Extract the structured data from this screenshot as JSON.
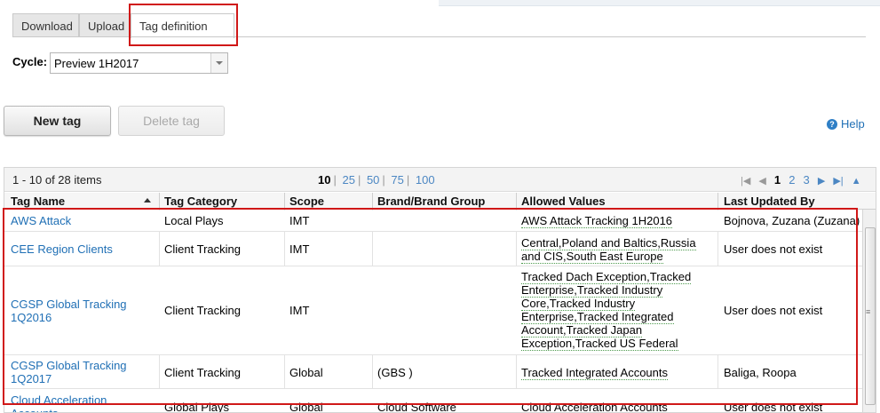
{
  "tabs": [
    {
      "label": "Download"
    },
    {
      "label": "Upload"
    },
    {
      "label": "Tag definition"
    }
  ],
  "cycle": {
    "label": "Cycle:",
    "value": "Preview 1H2017"
  },
  "buttons": {
    "new_tag": "New tag",
    "delete_tag": "Delete tag"
  },
  "help": {
    "label": "Help"
  },
  "pager": {
    "summary": "1 - 10 of 28 items",
    "page_sizes": [
      "10",
      "25",
      "50",
      "75",
      "100"
    ],
    "current_size": "10",
    "pages": [
      "1",
      "2",
      "3"
    ],
    "current_page": "1"
  },
  "columns": [
    "Tag Name",
    "Tag Category",
    "Scope",
    "Brand/Brand Group",
    "Allowed Values",
    "Last Updated By"
  ],
  "rows": [
    {
      "name": "AWS Attack",
      "category": "Local Plays",
      "scope": "IMT",
      "brand": "",
      "allowed": "AWS Attack Tracking 1H2016",
      "updated_by": "Bojnova, Zuzana (Zuzana)"
    },
    {
      "name": "CEE Region Clients",
      "category": "Client Tracking",
      "scope": "IMT",
      "brand": "",
      "allowed": "Central,Poland and Baltics,Russia and CIS,South East Europe",
      "updated_by": "User does not exist"
    },
    {
      "name": "CGSP Global Tracking 1Q2016",
      "category": "Client Tracking",
      "scope": "IMT",
      "brand": "",
      "allowed": "Tracked Dach Exception,Tracked Enterprise,Tracked Industry Core,Tracked Industry Enterprise,Tracked Integrated Account,Tracked Japan Exception,Tracked US Federal",
      "updated_by": "User does not exist"
    },
    {
      "name": "CGSP Global Tracking 1Q2017",
      "category": "Client Tracking",
      "scope": "Global",
      "brand": "(GBS )",
      "allowed": "Tracked Integrated Accounts",
      "updated_by": "Baliga, Roopa"
    },
    {
      "name": "Cloud Acceleration Accounts",
      "category": "Global Plays",
      "scope": "Global",
      "brand": "Cloud Software",
      "allowed": "Cloud Acceleration Accounts",
      "updated_by": "User does not exist"
    }
  ]
}
